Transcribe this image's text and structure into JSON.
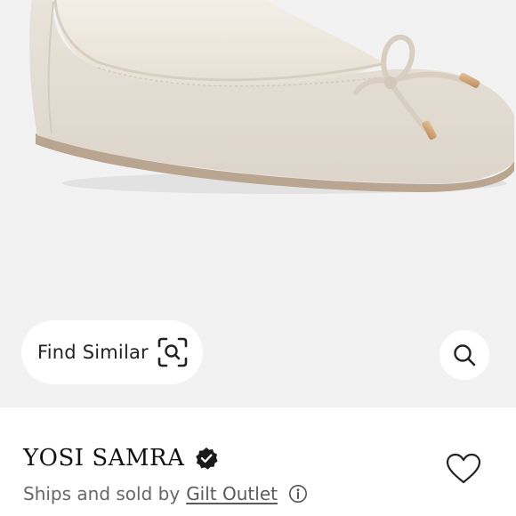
{
  "product": {
    "image_alt": "Beige suede ballet flat with bow",
    "brand": "YOSI SAMRA",
    "verified_icon": "verified-check-badge-icon"
  },
  "overlay": {
    "find_similar_label": "Find Similar",
    "find_similar_icon": "scan-search-icon",
    "search_icon": "magnifier-icon"
  },
  "seller": {
    "prefix": "Ships and sold by",
    "name": "Gilt Outlet",
    "info_icon": "info-circle-icon"
  },
  "actions": {
    "like_icon": "heart-outline-icon"
  },
  "colors": {
    "image_background": "#f2f2f2",
    "shoe": "#e4ddd3",
    "text_primary": "#111111",
    "text_secondary": "#666666"
  }
}
